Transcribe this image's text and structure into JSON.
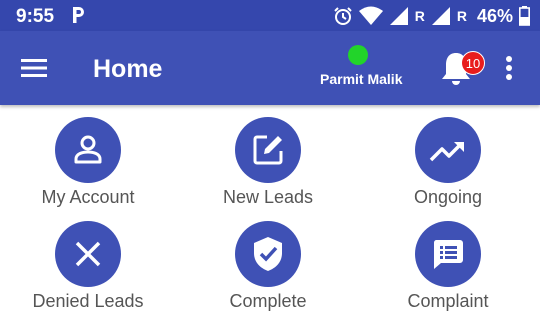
{
  "status_bar": {
    "time": "9:55",
    "carrier_icon": "parking-icon",
    "roaming_1": "R",
    "roaming_2": "R",
    "battery": "46%"
  },
  "app_bar": {
    "title": "Home",
    "user_name": "Parmit Malik",
    "notification_count": "10",
    "online_color": "#22d42a"
  },
  "tiles": [
    {
      "label": "My Account",
      "icon": "person-icon"
    },
    {
      "label": "New Leads",
      "icon": "edit-box-icon"
    },
    {
      "label": "Ongoing",
      "icon": "trending-up-icon"
    },
    {
      "label": "Denied Leads",
      "icon": "close-icon"
    },
    {
      "label": "Complete",
      "icon": "shield-check-icon"
    },
    {
      "label": "Complaint",
      "icon": "chat-list-icon"
    }
  ],
  "colors": {
    "primary": "#3f51b5",
    "status_bar": "#3547ad",
    "badge": "#e81d1d",
    "label_text": "#555555"
  }
}
